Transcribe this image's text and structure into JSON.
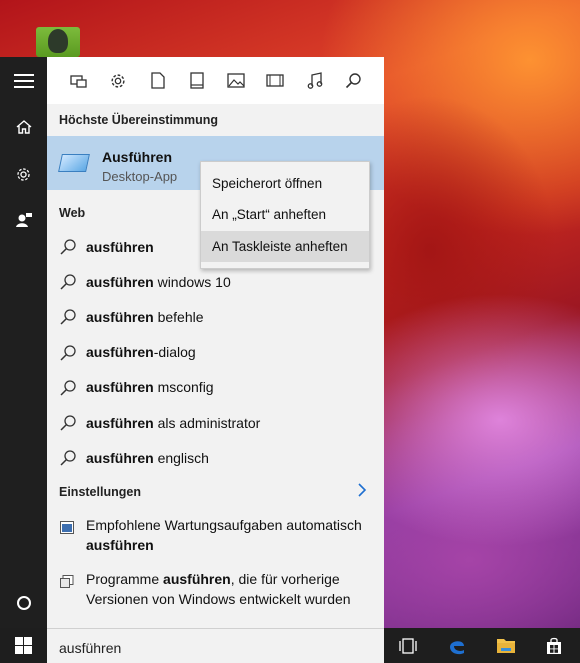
{
  "desktop": {
    "icon_name": "evernote-icon"
  },
  "rail": {
    "items": [
      {
        "name": "hamburger-menu-icon"
      },
      {
        "name": "home-icon"
      },
      {
        "name": "gear-icon"
      },
      {
        "name": "user-feedback-icon"
      },
      {
        "name": "cortana-circle-icon"
      }
    ]
  },
  "toolbar": {
    "filters": [
      "apps-filter-icon",
      "settings-filter-icon",
      "documents-filter-icon",
      "folders-filter-icon",
      "photos-filter-icon",
      "videos-filter-icon",
      "music-filter-icon",
      "search-icon"
    ]
  },
  "best_match": {
    "header": "Höchste Übereinstimmung",
    "title": "Ausführen",
    "subtitle": "Desktop-App"
  },
  "context_menu": {
    "items": [
      "Speicherort öffnen",
      "An „Start“ anheften",
      "An Taskleiste anheften"
    ],
    "highlighted_index": 2
  },
  "web": {
    "header": "Web",
    "results": [
      {
        "bold": "ausführen",
        "rest": ""
      },
      {
        "bold": "ausführen",
        "rest": " windows 10"
      },
      {
        "bold": "ausführen",
        "rest": " befehle"
      },
      {
        "bold": "ausführen",
        "rest": "-dialog"
      },
      {
        "bold": "ausführen",
        "rest": " msconfig"
      },
      {
        "bold": "ausführen",
        "rest": " als administrator"
      },
      {
        "bold": "ausführen",
        "rest": " englisch"
      }
    ]
  },
  "settings": {
    "header": "Einstellungen",
    "results": [
      {
        "pre": "Empfohlene Wartungsaufgaben automatisch ",
        "bold": "ausführen",
        "post": ""
      },
      {
        "pre": "Programme ",
        "bold": "ausführen",
        "post": ", die für vorherige Versionen von Windows entwickelt wurden"
      }
    ]
  },
  "taskbar": {
    "search_value": "ausführen",
    "apps": [
      "task-view-icon",
      "edge-icon",
      "file-explorer-icon",
      "store-icon"
    ]
  },
  "colors": {
    "accent_best_match": "#b8d3ec",
    "rail_bg": "#1f1f1f",
    "edge_blue": "#1e6fd0"
  }
}
